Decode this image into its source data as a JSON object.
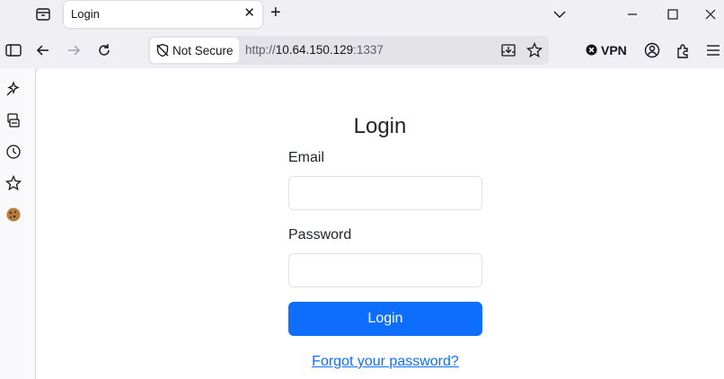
{
  "tab": {
    "title": "Login",
    "close_glyph": "✕",
    "new_tab_glyph": "+"
  },
  "navbar": {
    "security_label": "Not Secure",
    "url_protocol": "http://",
    "url_host": "10.64.150.129",
    "url_port": ":1337",
    "vpn_label": "VPN"
  },
  "page": {
    "title": "Login",
    "email_label": "Email",
    "email_value": "",
    "password_label": "Password",
    "password_value": "",
    "login_button": "Login",
    "forgot_link": "Forgot your password?"
  },
  "colors": {
    "primary": "#0d6efd",
    "chrome_bg": "#f0f0f4",
    "text": "#212529"
  }
}
